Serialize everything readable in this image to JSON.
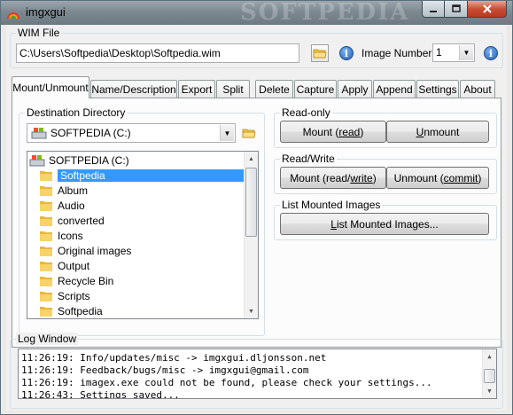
{
  "window": {
    "title": "imgxgui",
    "watermark": "SOFTPEDIA"
  },
  "wim": {
    "legend": "WIM File",
    "path": "C:\\Users\\Softpedia\\Desktop\\Softpedia.wim",
    "image_number_label": "Image Number:",
    "image_number_value": "1"
  },
  "tabs": [
    {
      "label": "Mount/Unmount",
      "active": true
    },
    {
      "label": "Name/Description"
    },
    {
      "label": "Export"
    },
    {
      "label": "Split"
    },
    {
      "label": "Delete"
    },
    {
      "label": "Capture"
    },
    {
      "label": "Apply"
    },
    {
      "label": "Append"
    },
    {
      "label": "Settings"
    },
    {
      "label": "About"
    }
  ],
  "mount": {
    "dest_legend": "Destination Directory",
    "drive_value": "SOFTPEDIA (C:)",
    "tree": [
      {
        "label": "SOFTPEDIA (C:)",
        "icon": "drive-icon"
      },
      {
        "label": "Softpedia",
        "selected": true
      },
      {
        "label": "Album"
      },
      {
        "label": "Audio"
      },
      {
        "label": "converted"
      },
      {
        "label": "Icons"
      },
      {
        "label": "Original images"
      },
      {
        "label": "Output"
      },
      {
        "label": "Recycle Bin"
      },
      {
        "label": "Scripts"
      },
      {
        "label": "Softpedia"
      }
    ],
    "readonly": {
      "legend": "Read-only",
      "mount_prefix": "Mount (",
      "mount_u": "read",
      "mount_suffix": ")",
      "unmount_u": "U",
      "unmount_rest": "nmount"
    },
    "readwrite": {
      "legend": "Read/Write",
      "mount_prefix": "Mount (read/",
      "mount_u": "write",
      "mount_suffix": ")",
      "unmount_prefix": "Unmount (",
      "unmount_u": "commit",
      "unmount_suffix": ")"
    },
    "list": {
      "legend": "List Mounted Images",
      "button_u": "L",
      "button_rest": "ist Mounted Images..."
    }
  },
  "log": {
    "legend": "Log Window",
    "lines": [
      "11:26:19: Info/updates/misc -> imgxgui.dljonsson.net",
      "11:26:19: Feedback/bugs/misc -> imgxgui@gmail.com",
      "11:26:19: imagex.exe could not be found, please check your settings...",
      "11:26:43: Settings saved..."
    ]
  }
}
